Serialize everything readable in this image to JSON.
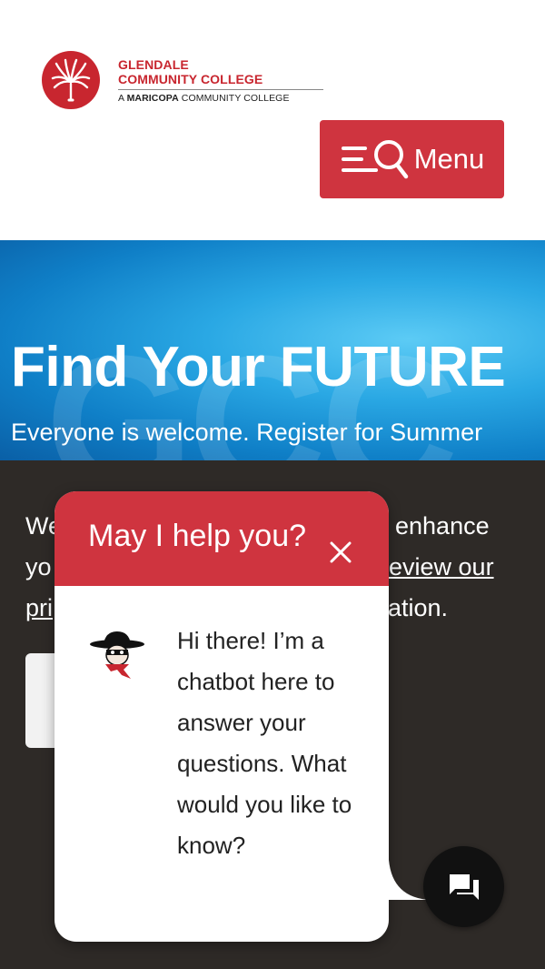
{
  "header": {
    "logo": {
      "line1": "GLENDALE",
      "line2": "COMMUNITY COLLEGE",
      "line3_prefix": "A",
      "line3_bold": "MARICOPA",
      "line3_suffix": "COMMUNITY COLLEGE",
      "icon": "palm-tree-icon"
    },
    "menu_button": {
      "label": "Menu",
      "icons": [
        "hamburger-icon",
        "search-icon"
      ]
    }
  },
  "hero": {
    "title": "Find Your FUTURE",
    "subtitle": "Everyone is welcome. Register for Summer",
    "watermark": "GCC"
  },
  "cookie_banner": {
    "text_visible": [
      {
        "part": "We",
        "line": 1
      },
      {
        "part": "enhance",
        "line": 1
      },
      {
        "part": "yo",
        "line": 2
      },
      {
        "part": "eview our",
        "line": 2
      },
      {
        "part": "pri",
        "line": 3
      },
      {
        "part": "ation.",
        "line": 3
      }
    ]
  },
  "chat": {
    "title": "May I help you?",
    "close_icon": "close-icon",
    "avatar": "gaucho-mascot-icon",
    "message": "Hi there!  I’m a chatbot here to answer your questions. What would you like to know?",
    "fab_icon": "chat-bubbles-icon"
  },
  "colors": {
    "brand_red": "#cf343f",
    "hero_blue": "#2aa8e4",
    "banner_dark": "#2e2a27",
    "fab_black": "#111111"
  }
}
